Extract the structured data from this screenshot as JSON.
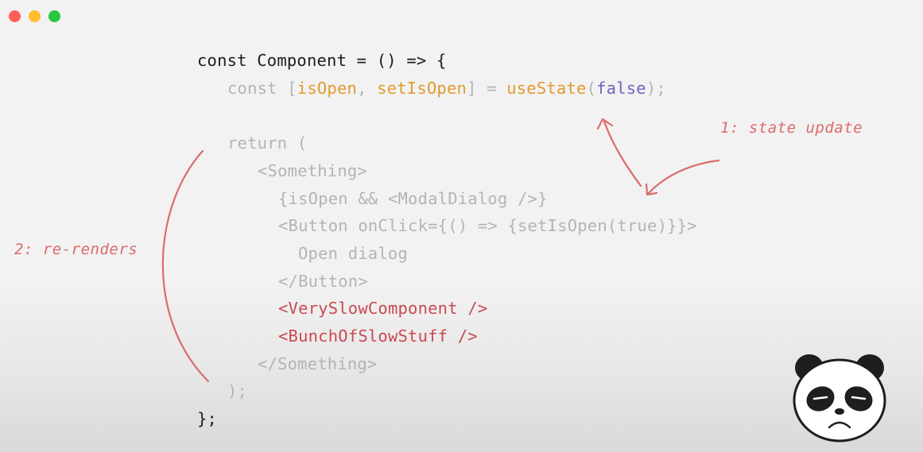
{
  "window": {
    "controls": [
      {
        "name": "close",
        "color": "#ff5f57"
      },
      {
        "name": "minimize",
        "color": "#febc2e"
      },
      {
        "name": "maximize",
        "color": "#28c840"
      }
    ]
  },
  "code": {
    "line1": "const Component = () => {",
    "line2_const": "const [",
    "line2_isOpen": "isOpen",
    "line2_comma": ", ",
    "line2_setter": "setIsOpen",
    "line2_eq": "] = ",
    "line2_useState": "useState",
    "line2_paren_open": "(",
    "line2_false": "false",
    "line2_end": ");",
    "line3": "return (",
    "line4": "<Something>",
    "line5": "{isOpen && <ModalDialog />}",
    "line6": "<Button onClick={() => {setIsOpen(true)}}>",
    "line7": "Open dialog",
    "line8": "</Button>",
    "line9": "<VerySlowComponent />",
    "line10": "<BunchOfSlowStuff />",
    "line11": "</Something>",
    "line12": ");",
    "line13": "};"
  },
  "annotations": {
    "state_update": "1: state update",
    "re_renders": "2: re-renders"
  },
  "icons": {
    "mascot": "sad-panda-icon"
  },
  "colors": {
    "code_dark": "#1d1d1d",
    "code_muted": "#b4b4b4",
    "keyword_orange": "#e39a2e",
    "literal_purple": "#7261bd",
    "highlight_red": "#c94a52",
    "annotation_red": "#dc6b6b"
  }
}
